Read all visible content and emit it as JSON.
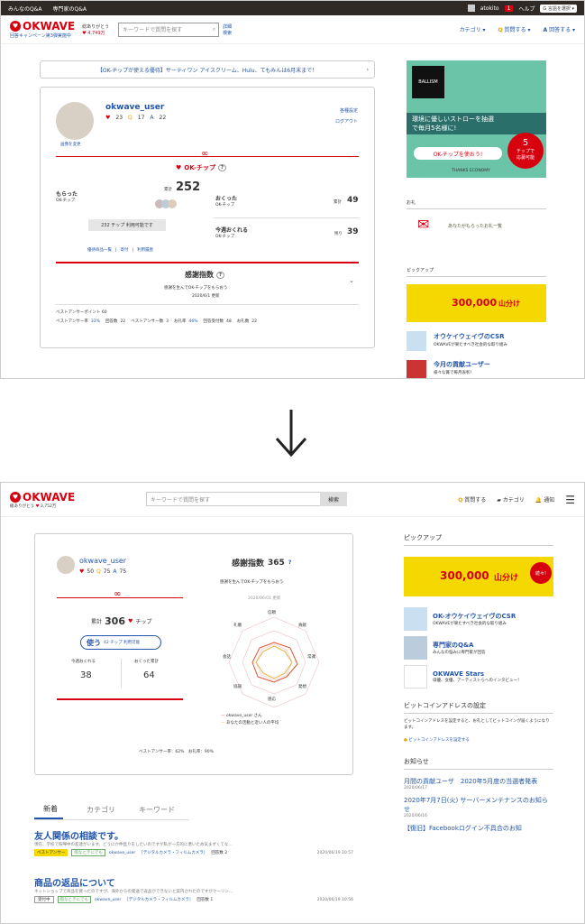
{
  "old": {
    "topbar": {
      "left1": "みんなのQ&A",
      "left2": "専門家のQ&A",
      "user": "atokito",
      "badge": "1",
      "help": "ヘルプ",
      "lang": "言語を選択"
    },
    "header": {
      "logo": "OKWAVE",
      "logo_sub": "回答キャンペーン第3弾実施中",
      "thanks": "総ありがとう",
      "count": "4,749万",
      "search_ph": "キーワードで質問を探す",
      "detail": "詳細",
      "detail2": "検索",
      "category": "カテゴリ",
      "ask": "質問する",
      "answer": "回答する"
    },
    "notice": "【OK-チップが使える優待】サーティワン アイスクリーム、Hulu、てもみんは6月末まで！",
    "profile": {
      "name": "okwave_user",
      "hearts": "23",
      "q": "17",
      "a": "22",
      "change_img": "画像を変更",
      "settings": "各種設定",
      "logout": "ログアウト"
    },
    "chip": {
      "title": "OK-チップ",
      "received": "もらった",
      "received_sub": "OK-チップ",
      "total_label": "累計",
      "total": "252",
      "usable": "232 チップ 利用可能です",
      "sent": "おくった",
      "sent_sub": "OK-チップ",
      "sent_total_label": "累計",
      "sent_total": "49",
      "month": "今週おくれる",
      "month_sub": "OK-チップ",
      "month_left": "残り",
      "month_val": "39",
      "links": [
        "優待商品一覧",
        "寄付",
        "利用履歴"
      ]
    },
    "kansha": {
      "title": "感謝指数",
      "desc": "感謝を生んでOK-チップをもらおう",
      "date": "2020/6/1 更新"
    },
    "stats": {
      "line1": "ベストアンサーポイント 60",
      "ba_rate_label": "ベストアンサー率",
      "ba_rate": "33%",
      "answers_label": "回答数",
      "answers": "22",
      "ba_count_label": "ベストアンサー数",
      "ba_count": "3",
      "thanks_rate_label": "お礼率",
      "thanks_rate": "46%",
      "q_received_label": "回答受付数",
      "q_received": "48",
      "thanks_count_label": "お礼数",
      "thanks_count": "22"
    },
    "side": {
      "ad_brand": "BALLISM",
      "ad_text1": "環境に優しいストローを抽選",
      "ad_text2": "で毎月5名様に!",
      "ad_btn": "OK-チップを使おう!",
      "ad_badge1": "5",
      "ad_badge2": "チップで",
      "ad_badge3": "応募可能",
      "ad_foot": "THANKS ECONOMY",
      "thanks_head": "お礼",
      "thanks_link": "あなたがもらったお礼一覧",
      "pickup": "ピックアップ",
      "pickup_banner1": "300,000",
      "pickup_banner2": "山分け",
      "csr": "オウケイウェイヴのCSR",
      "csr_sub": "OKWAVEが果たすべき社会的な取り組み",
      "contrib": "今月の貢献ユーザー",
      "contrib_sub": "様々な賞で毎月表彰！"
    }
  },
  "new": {
    "header": {
      "logo": "OKWAVE",
      "thanks": "総ありがとう",
      "count": "3,752万",
      "search_ph": "キーワードで質問を探す",
      "search_btn": "検索",
      "ask": "質問する",
      "category": "カテゴリ",
      "notify": "通知"
    },
    "profile": {
      "name": "okwave_user",
      "hearts": "50",
      "q": "75",
      "a": "75"
    },
    "chip": {
      "total_label": "累計",
      "total": "306",
      "unit": "チップ",
      "use": "使う",
      "usable": "42 チップ 利用可能",
      "month": "今週おくれる",
      "month_val": "38",
      "sent": "おくった累計",
      "sent_val": "64"
    },
    "kansha": {
      "title": "感謝指数",
      "value": "365",
      "desc": "感謝を生んでOK-チップをもらおう",
      "date": "2020/06/01 更新",
      "axes": [
        "信頼",
        "貢献",
        "常識",
        "発想",
        "感応",
        "協調",
        "会話",
        "礼儀"
      ],
      "legend1": "okwave_user さん",
      "legend2": "あなたの活動と近い人の平均",
      "foot": "ベストアンサー率：62%　お礼率：90%"
    },
    "tabs": [
      "新着",
      "カテゴリ",
      "キーワード"
    ],
    "questions": [
      {
        "title": "友人関係の相談です。",
        "body": "現在、学校で喧嘩中の友達がいます。どうにか仲直りをしたいのですが私が一方的に悪いため気まずくてな...",
        "badge": "ベストアンサー",
        "tag": "暇なときにでも",
        "user": "okwave_user",
        "cat": "［デジタルカメラ・フィルムカメラ］",
        "answers": "回答数 2",
        "date": "2020/06/19 10:57"
      },
      {
        "title": "商品の返品について",
        "body": "ネットショップで商品を買ったのですが、海外からの発送で返品ができないと案内されたのですがクーリン...",
        "badge": "受付中",
        "tag": "暇なときにでも",
        "user": "okwave_user",
        "cat": "［デジタルカメラ・フィルムカメラ］",
        "answers": "回答数 1",
        "date": "2020/06/19 10:56"
      }
    ],
    "side": {
      "pickup": "ピックアップ",
      "banner1": "300,000",
      "banner2": "山分け",
      "banner3": "続々!",
      "csr": "OK-オウケイウェイヴのCSR",
      "csr_sub": "OKWAVEが果たすべき社会的な取り組み",
      "expert": "専門家のQ&A",
      "expert_sub": "みんなの悩みに専門家が回答",
      "stars": "OKWAVE Stars",
      "stars_sub": "俳優、女優、アーティストらへのインタビュー！",
      "btc_head": "ビットコインアドレスの設定",
      "btc_text": "ビットコインアドレスを設定すると、お礼としてビットコインが届くようになります。",
      "btc_link": "ビットコインアドレスを設定する",
      "news_head": "お知らせ",
      "news": [
        {
          "t": "月間の貢献ユーザ　2020年5月度の当選者発表",
          "d": "2020/06/17"
        },
        {
          "t": "2020年7月7日(火) サーバーメンテナンスのお知らせ",
          "d": "2020/06/16"
        },
        {
          "t": "【復旧】Facebookログイン不具合のお知",
          "d": ""
        }
      ]
    }
  }
}
